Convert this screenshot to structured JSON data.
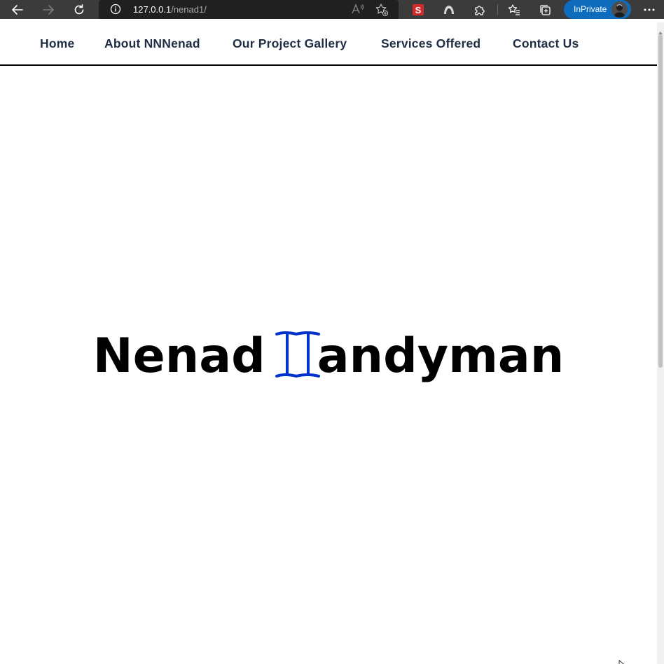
{
  "browser": {
    "url_host": "127.0.0.1",
    "url_path": "/nenad1/",
    "inprivate_label": "InPrivate"
  },
  "icons": {
    "back": "back-arrow-icon",
    "forward": "forward-arrow-icon",
    "refresh": "refresh-icon",
    "site_info": "info-icon",
    "read_aloud": "read-aloud-icon",
    "add_favorite": "add-favorite-icon",
    "extension_red": "extension-s-icon",
    "extension_arc": "extension-arc-icon",
    "extensions": "puzzle-icon",
    "favorites": "favorites-icon",
    "collections": "collections-icon",
    "menu": "more-icon",
    "avatar": "avatar-icon",
    "logo": "handyman-logo-icon"
  },
  "colors": {
    "nav_text": "#1f2d44",
    "logo_blue": "#0033cc",
    "chrome_bg": "#3b3b3b",
    "inprivate_blue": "#0f6cbd"
  },
  "nav": {
    "items": [
      {
        "label": "Home"
      },
      {
        "label": "About NNNenad"
      },
      {
        "label": "Our Project Gallery"
      },
      {
        "label": "Services Offered"
      },
      {
        "label": "Contact Us"
      }
    ]
  },
  "hero": {
    "title_part1": "Nenad",
    "title_part2": "andyman"
  }
}
